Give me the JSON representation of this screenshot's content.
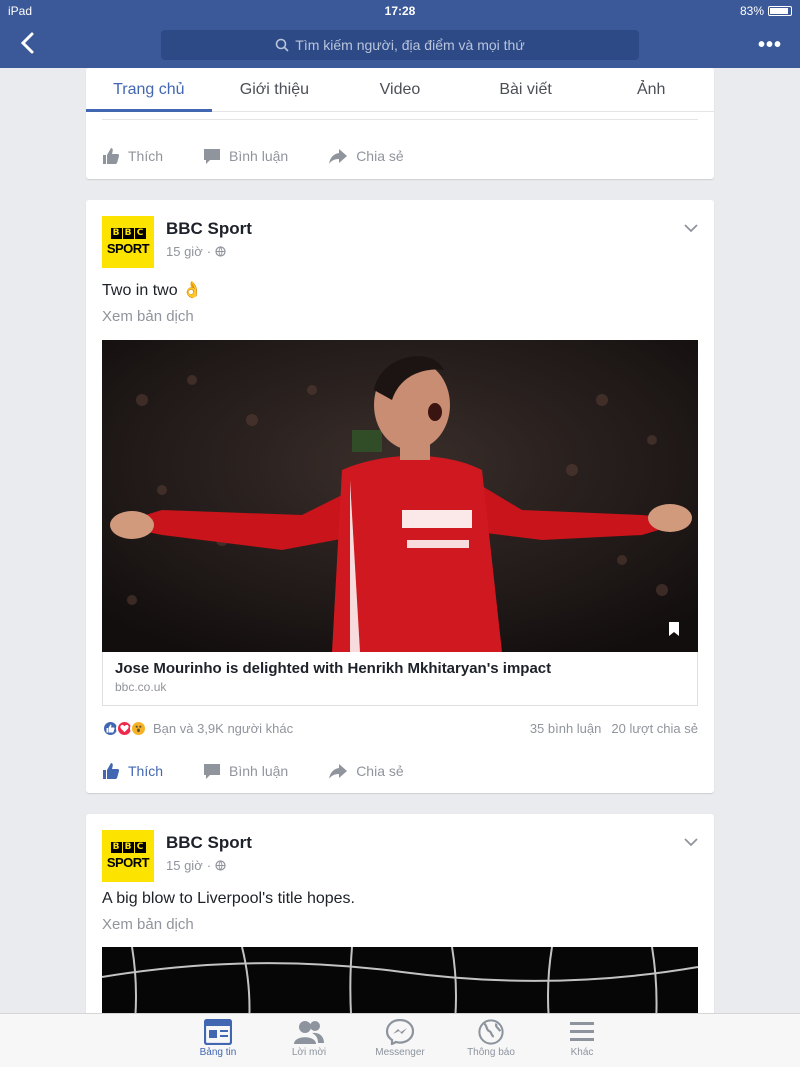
{
  "status_bar": {
    "device": "iPad",
    "time": "17:28",
    "battery": "83%"
  },
  "nav": {
    "search_placeholder": "Tìm kiếm người, địa điểm và mọi thứ"
  },
  "page_tabs": [
    {
      "label": "Trang chủ",
      "active": true
    },
    {
      "label": "Giới thiệu",
      "active": false
    },
    {
      "label": "Video",
      "active": false
    },
    {
      "label": "Bài viết",
      "active": false
    },
    {
      "label": "Ảnh",
      "active": false
    }
  ],
  "actions": {
    "like": "Thích",
    "comment": "Bình luận",
    "share": "Chia sẻ"
  },
  "post1": {
    "author": "BBC Sport",
    "logo_text": {
      "letters": [
        "B",
        "B",
        "C"
      ],
      "sport": "SPORT"
    },
    "time": "15 giờ",
    "text": "Two in two 👌",
    "translate": "Xem bản dịch",
    "link_title": "Jose Mourinho is delighted with Henrikh Mkhitaryan's impact",
    "link_domain": "bbc.co.uk",
    "reactions_summary": "Bạn và 3,9K người khác",
    "comments": "35 bình luận",
    "shares": "20 lượt chia sẻ",
    "liked": true
  },
  "post2": {
    "author": "BBC Sport",
    "time": "15 giờ",
    "text": "A big blow to Liverpool's title hopes.",
    "translate": "Xem bản dịch"
  },
  "tabbar": [
    {
      "label": "Bảng tin",
      "icon": "news-feed-icon",
      "active": true
    },
    {
      "label": "Lời mời",
      "icon": "friend-requests-icon",
      "active": false
    },
    {
      "label": "Messenger",
      "icon": "messenger-icon",
      "active": false
    },
    {
      "label": "Thông báo",
      "icon": "globe-icon",
      "active": false
    },
    {
      "label": "Khác",
      "icon": "menu-icon",
      "active": false
    }
  ],
  "colors": {
    "brand": "#3b5998",
    "accent": "#4267b2",
    "bbc_yellow": "#fce300"
  }
}
